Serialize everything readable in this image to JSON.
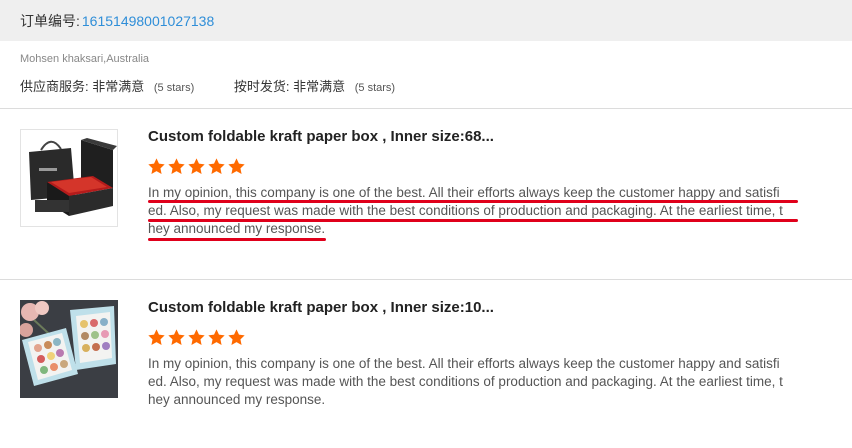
{
  "order": {
    "label": "订单编号:",
    "number": "16151498001027138"
  },
  "buyer": {
    "name_location": "Mohsen khaksari,Australia"
  },
  "ratings": [
    {
      "label": "供应商服务:",
      "value": "非常满意",
      "stars_note": "(5 stars)"
    },
    {
      "label": "按时发货:",
      "value": "非常满意",
      "stars_note": "(5 stars)"
    }
  ],
  "reviews": [
    {
      "product_title": "Custom foldable kraft paper box , Inner size:68...",
      "rating": 5,
      "review_lines": [
        "In my opinion, this company is one of the best.  All their efforts always keep the customer happy and satisfi",
        "ed. Also, my request was made with the best conditions of production and packaging. At the earliest time, t",
        "hey announced my response."
      ]
    },
    {
      "product_title": "Custom foldable kraft paper box , Inner size:10...",
      "rating": 5,
      "review_lines": [
        "In my opinion, this company is one of the best.  All their efforts always keep the customer happy and satisfi",
        "ed. Also, my request was made with the best conditions of production and packaging. At the earliest time, t",
        "hey announced my response."
      ]
    }
  ],
  "colors": {
    "link": "#2f8ed8",
    "star": "#ff6a00",
    "underline_annotation": "#e0001b",
    "header_bg": "#efefef"
  },
  "icons": [
    "star-icon"
  ]
}
